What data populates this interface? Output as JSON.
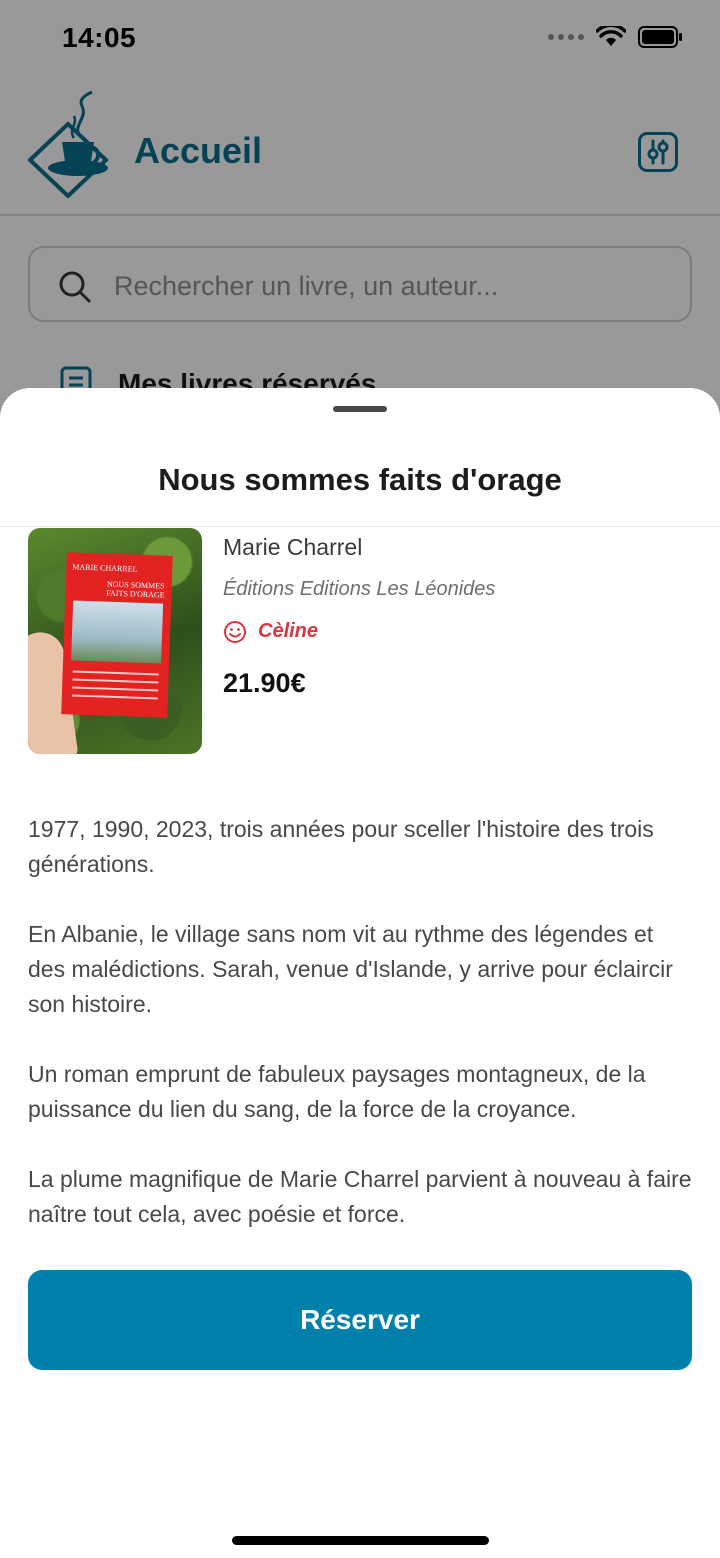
{
  "status_bar": {
    "time": "14:05"
  },
  "header": {
    "title": "Accueil"
  },
  "search": {
    "placeholder": "Rechercher un livre, un auteur..."
  },
  "section": {
    "reserved_label": "Mes livres réservés"
  },
  "sheet": {
    "title": "Nous sommes faits d'orage",
    "author": "Marie Charrel",
    "publisher": "Éditions Editions Les Léonides",
    "reviewer": "Cèline",
    "price": "21.90€",
    "cover": {
      "author_text": "MARIE CHARREL",
      "title_text": "NOUS SOMMES FAITS D'ORAGE"
    },
    "description": [
      "1977, 1990, 2023, trois années pour sceller l'histoire des trois générations.",
      "En Albanie, le village sans nom vit au rythme des légendes et des malédictions. Sarah, venue d'Islande, y arrive pour éclaircir son histoire.",
      "Un roman emprunt de fabuleux paysages montagneux, de la puissance du lien du sang, de la force de la croyance.",
      "La plume magnifique de Marie Charrel parvient à nouveau à faire naître tout cela, avec poésie et force."
    ],
    "button_label": "Réserver"
  },
  "colors": {
    "brand": "#0a6e8e",
    "button": "#0080aa",
    "reviewer": "#d9363e"
  },
  "icons": {
    "logo": "coffee-book-logo",
    "filter": "filter-icon",
    "search": "search-icon",
    "reserved": "document-icon",
    "reviewer": "smile-icon"
  }
}
